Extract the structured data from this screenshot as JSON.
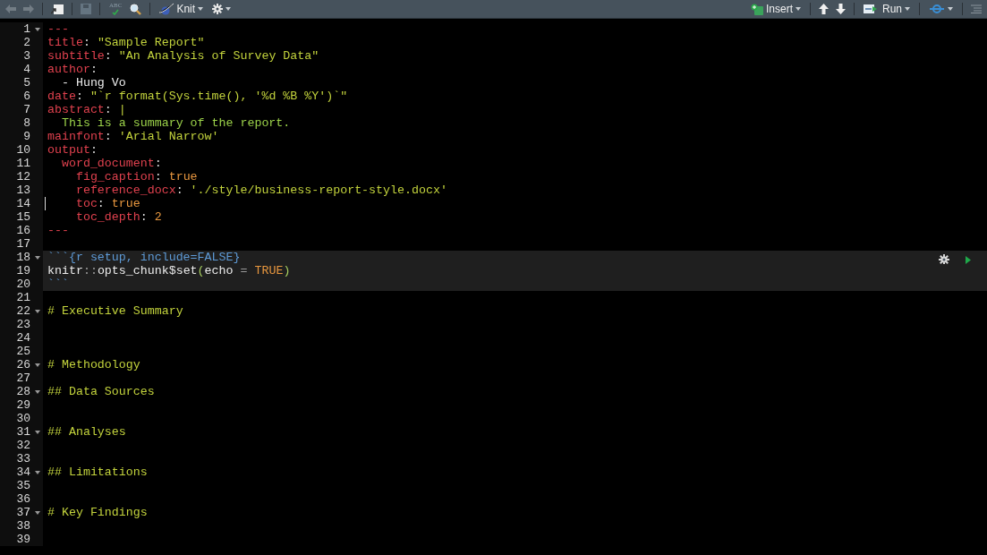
{
  "toolbar": {
    "back": {
      "disabled": true
    },
    "forward": {
      "disabled": true
    },
    "save": {
      "disabled": true
    },
    "spellcheck": {
      "label": "ABC"
    },
    "knit": {
      "label": "Knit"
    },
    "insert": {
      "label": "Insert"
    },
    "run": {
      "label": "Run"
    }
  },
  "editor": {
    "lines": [
      {
        "number": "1",
        "fold": true,
        "chunk": false,
        "cursor": false,
        "tokens": [
          {
            "kind": "key",
            "text": "---"
          }
        ]
      },
      {
        "number": "2",
        "fold": false,
        "chunk": false,
        "cursor": false,
        "tokens": [
          {
            "kind": "key",
            "text": "title"
          },
          {
            "kind": "punct",
            "text": ": "
          },
          {
            "kind": "string",
            "text": "\"Sample Report\""
          }
        ]
      },
      {
        "number": "3",
        "fold": false,
        "chunk": false,
        "cursor": false,
        "tokens": [
          {
            "kind": "key",
            "text": "subtitle"
          },
          {
            "kind": "punct",
            "text": ": "
          },
          {
            "kind": "string",
            "text": "\"An Analysis of Survey Data\""
          }
        ]
      },
      {
        "number": "4",
        "fold": false,
        "chunk": false,
        "cursor": false,
        "tokens": [
          {
            "kind": "key",
            "text": "author"
          },
          {
            "kind": "punct",
            "text": ":"
          }
        ]
      },
      {
        "number": "5",
        "fold": false,
        "chunk": false,
        "cursor": false,
        "tokens": [
          {
            "kind": "plain",
            "text": "  - Hung Vo"
          }
        ]
      },
      {
        "number": "6",
        "fold": false,
        "chunk": false,
        "cursor": false,
        "tokens": [
          {
            "kind": "key",
            "text": "date"
          },
          {
            "kind": "punct",
            "text": ": "
          },
          {
            "kind": "string",
            "text": "\"`r format(Sys.time(), '%d %B %Y')`\""
          }
        ]
      },
      {
        "number": "7",
        "fold": false,
        "chunk": false,
        "cursor": false,
        "tokens": [
          {
            "kind": "key",
            "text": "abstract"
          },
          {
            "kind": "punct",
            "text": ": "
          },
          {
            "kind": "string",
            "text": "|"
          }
        ]
      },
      {
        "number": "8",
        "fold": false,
        "chunk": false,
        "cursor": false,
        "tokens": [
          {
            "kind": "text",
            "text": "  This is a summary of the report."
          }
        ]
      },
      {
        "number": "9",
        "fold": false,
        "chunk": false,
        "cursor": false,
        "tokens": [
          {
            "kind": "key",
            "text": "mainfont"
          },
          {
            "kind": "punct",
            "text": ": "
          },
          {
            "kind": "string",
            "text": "'Arial Narrow'"
          }
        ]
      },
      {
        "number": "10",
        "fold": false,
        "chunk": false,
        "cursor": false,
        "tokens": [
          {
            "kind": "key",
            "text": "output"
          },
          {
            "kind": "punct",
            "text": ":"
          }
        ]
      },
      {
        "number": "11",
        "fold": false,
        "chunk": false,
        "cursor": false,
        "tokens": [
          {
            "kind": "key",
            "text": "  word_document"
          },
          {
            "kind": "punct",
            "text": ":"
          }
        ]
      },
      {
        "number": "12",
        "fold": false,
        "chunk": false,
        "cursor": false,
        "tokens": [
          {
            "kind": "key",
            "text": "    fig_caption"
          },
          {
            "kind": "punct",
            "text": ": "
          },
          {
            "kind": "value",
            "text": "true"
          }
        ]
      },
      {
        "number": "13",
        "fold": false,
        "chunk": false,
        "cursor": false,
        "tokens": [
          {
            "kind": "key",
            "text": "    reference_docx"
          },
          {
            "kind": "punct",
            "text": ": "
          },
          {
            "kind": "string",
            "text": "'./style/business-report-style.docx'"
          }
        ]
      },
      {
        "number": "14",
        "fold": false,
        "chunk": false,
        "cursor": true,
        "tokens": [
          {
            "kind": "key",
            "text": "    toc"
          },
          {
            "kind": "punct",
            "text": ": "
          },
          {
            "kind": "value",
            "text": "true"
          }
        ]
      },
      {
        "number": "15",
        "fold": false,
        "chunk": false,
        "cursor": false,
        "tokens": [
          {
            "kind": "key",
            "text": "    toc_depth"
          },
          {
            "kind": "punct",
            "text": ": "
          },
          {
            "kind": "value",
            "text": "2"
          }
        ]
      },
      {
        "number": "16",
        "fold": false,
        "chunk": false,
        "cursor": false,
        "tokens": [
          {
            "kind": "key",
            "text": "---"
          }
        ]
      },
      {
        "number": "17",
        "fold": false,
        "chunk": false,
        "cursor": false
      },
      {
        "number": "18",
        "fold": true,
        "chunk": true,
        "cursor": false,
        "tokens": [
          {
            "kind": "chunk",
            "text": "```{r setup, include=FALSE}"
          }
        ]
      },
      {
        "number": "19",
        "fold": false,
        "chunk": true,
        "cursor": false,
        "tokens": [
          {
            "kind": "plain",
            "text": "knitr"
          },
          {
            "kind": "op",
            "text": "::"
          },
          {
            "kind": "plain",
            "text": "opts_chunk$set"
          },
          {
            "kind": "paren",
            "text": "("
          },
          {
            "kind": "plain",
            "text": "echo "
          },
          {
            "kind": "op",
            "text": "="
          },
          {
            "kind": "value",
            "text": " TRUE"
          },
          {
            "kind": "paren",
            "text": ")"
          }
        ]
      },
      {
        "number": "20",
        "fold": false,
        "chunk": true,
        "cursor": false,
        "tokens": [
          {
            "kind": "chunk",
            "text": "```"
          }
        ]
      },
      {
        "number": "21",
        "fold": false,
        "chunk": false,
        "cursor": false
      },
      {
        "number": "22",
        "fold": true,
        "chunk": false,
        "cursor": false,
        "tokens": [
          {
            "kind": "header",
            "text": "# Executive Summary"
          }
        ]
      },
      {
        "number": "23",
        "fold": false,
        "chunk": false,
        "cursor": false
      },
      {
        "number": "24",
        "fold": false,
        "chunk": false,
        "cursor": false
      },
      {
        "number": "25",
        "fold": false,
        "chunk": false,
        "cursor": false
      },
      {
        "number": "26",
        "fold": true,
        "chunk": false,
        "cursor": false,
        "tokens": [
          {
            "kind": "header",
            "text": "# Methodology"
          }
        ]
      },
      {
        "number": "27",
        "fold": false,
        "chunk": false,
        "cursor": false
      },
      {
        "number": "28",
        "fold": true,
        "chunk": false,
        "cursor": false,
        "tokens": [
          {
            "kind": "header",
            "text": "## Data Sources"
          }
        ]
      },
      {
        "number": "29",
        "fold": false,
        "chunk": false,
        "cursor": false
      },
      {
        "number": "30",
        "fold": false,
        "chunk": false,
        "cursor": false
      },
      {
        "number": "31",
        "fold": true,
        "chunk": false,
        "cursor": false,
        "tokens": [
          {
            "kind": "header",
            "text": "## Analyses"
          }
        ]
      },
      {
        "number": "32",
        "fold": false,
        "chunk": false,
        "cursor": false
      },
      {
        "number": "33",
        "fold": false,
        "chunk": false,
        "cursor": false
      },
      {
        "number": "34",
        "fold": true,
        "chunk": false,
        "cursor": false,
        "tokens": [
          {
            "kind": "header",
            "text": "## Limitations"
          }
        ]
      },
      {
        "number": "35",
        "fold": false,
        "chunk": false,
        "cursor": false
      },
      {
        "number": "36",
        "fold": false,
        "chunk": false,
        "cursor": false
      },
      {
        "number": "37",
        "fold": true,
        "chunk": false,
        "cursor": false,
        "tokens": [
          {
            "kind": "header",
            "text": "# Key Findings"
          }
        ]
      },
      {
        "number": "38",
        "fold": false,
        "chunk": false,
        "cursor": false
      },
      {
        "number": "39",
        "fold": false,
        "chunk": false,
        "cursor": false
      }
    ]
  }
}
